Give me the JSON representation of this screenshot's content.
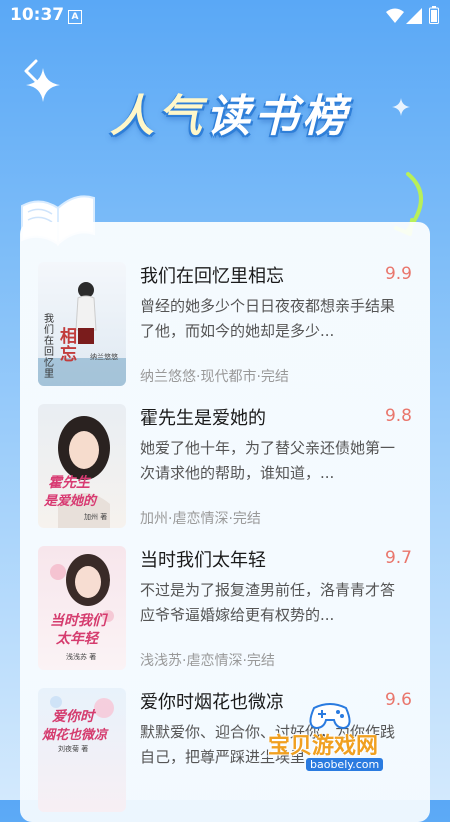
{
  "status": {
    "time": "10:37",
    "notif_glyph": "A"
  },
  "header": {
    "title_part1": "人气",
    "title_part2": "读书榜"
  },
  "books": [
    {
      "name": "我们在回忆里相忘",
      "score": "9.9",
      "desc": "曾经的她多少个日日夜夜都想亲手结果了他，而如今的她却是多少...",
      "meta": "纳兰悠悠·现代都市·完结",
      "cover_title": "我们在回忆里",
      "cover_big": "相忘",
      "cover_author": "纳兰悠悠"
    },
    {
      "name": "霍先生是爱她的",
      "score": "9.8",
      "desc": "她爱了他十年，为了替父亲还债她第一次请求他的帮助，谁知道，...",
      "meta": "加州·虐恋情深·完结",
      "cover_title": "霍先生",
      "cover_big": "是爱她的",
      "cover_author": "加州 著"
    },
    {
      "name": "当时我们太年轻",
      "score": "9.7",
      "desc": "不过是为了报复渣男前任，洛青青才答应爷爷逼婚嫁给更有权势的...",
      "meta": "浅浅苏·虐恋情深·完结",
      "cover_title": "当时我们",
      "cover_big": "太年轻",
      "cover_author": "浅浅苏 著"
    },
    {
      "name": "爱你时烟花也微凉",
      "score": "9.6",
      "desc": "默默爱你、迎合你、讨好你，为你作践自己，把尊严踩进尘埃里...",
      "meta": "",
      "cover_title": "爱你时",
      "cover_big": "烟花也微凉",
      "cover_author": "刘夜菊 著"
    }
  ],
  "watermark": {
    "line1": "宝贝游戏网",
    "line2": "baobely.com"
  },
  "colors": {
    "score": "#e9766c",
    "accent": "#3d8ae8"
  }
}
